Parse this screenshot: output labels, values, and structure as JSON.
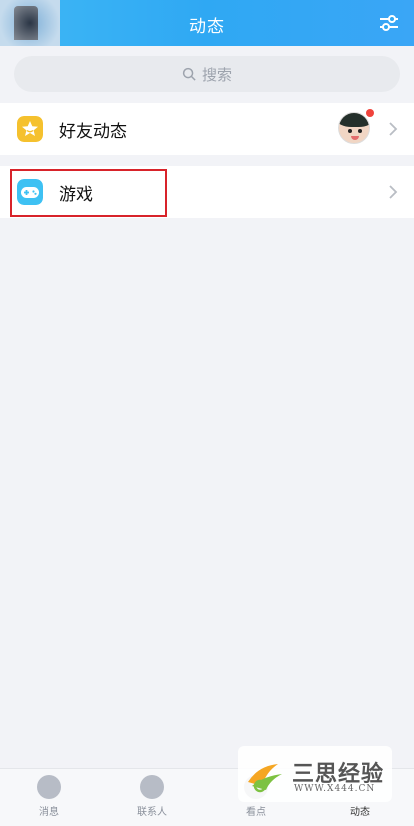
{
  "header": {
    "title": "动态"
  },
  "search": {
    "placeholder": "搜索"
  },
  "list": {
    "items": [
      {
        "label": "好友动态",
        "icon": "star-icon",
        "color": "#f5c12e"
      },
      {
        "label": "游戏",
        "icon": "gamepad-icon",
        "color": "#3ec1f3"
      }
    ]
  },
  "tabbar": {
    "tabs": [
      {
        "label": "消息",
        "icon": "message-icon"
      },
      {
        "label": "联系人",
        "icon": "contacts-icon"
      },
      {
        "label": "看点",
        "icon": "look-icon"
      },
      {
        "label": "动态",
        "icon": "news-feed-icon",
        "active": true
      }
    ]
  },
  "watermark": {
    "text": "三思经验",
    "url": "WWW.X444.CN"
  },
  "colors": {
    "header": "#2fa8f3",
    "highlight": "#d8232a",
    "notification_dot": "#f0433c"
  }
}
